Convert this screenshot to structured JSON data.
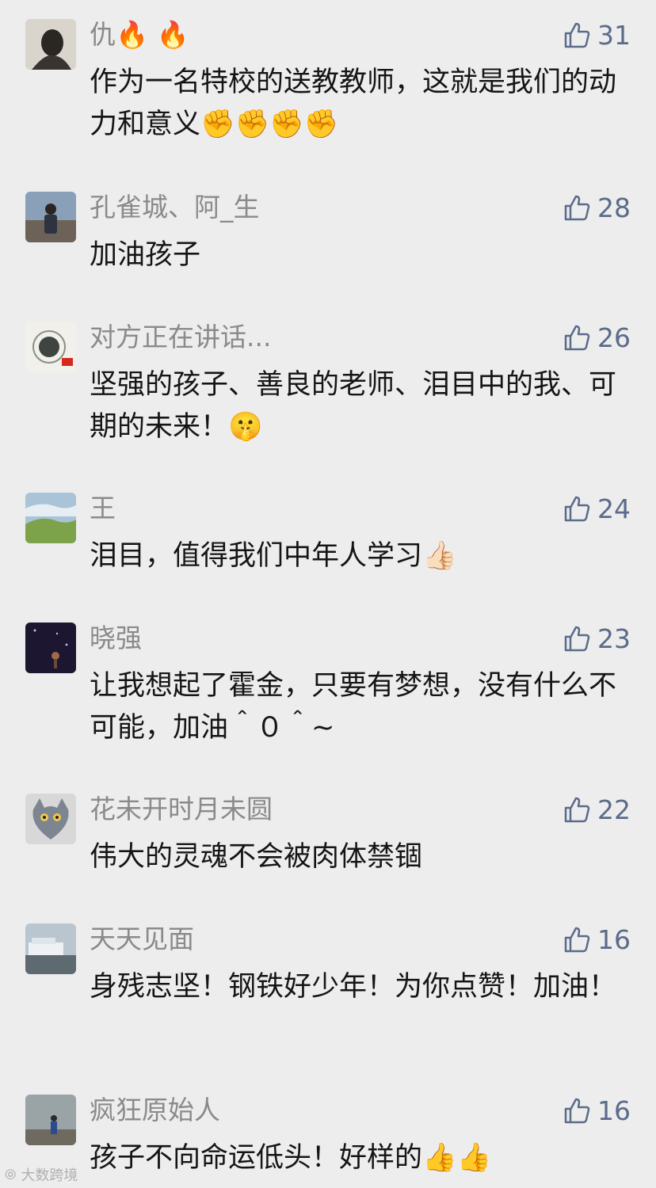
{
  "comments": [
    {
      "name": "仇🔥 🔥",
      "text": "作为一名特校的送教教师，这就是我们的动力和意义✊✊✊✊",
      "likes": "31",
      "avatar": "avatar-1"
    },
    {
      "name": "孔雀城、阿_生",
      "text": "加油孩子",
      "likes": "28",
      "avatar": "avatar-2"
    },
    {
      "name": "对方正在讲话...",
      "text": "坚强的孩子、善良的老师、泪目中的我、可期的未来！🤫",
      "likes": "26",
      "avatar": "avatar-3"
    },
    {
      "name": "王",
      "text": "泪目，值得我们中年人学习👍🏻",
      "likes": "24",
      "avatar": "avatar-4"
    },
    {
      "name": "晓强",
      "text": "让我想起了霍金，只要有梦想，没有什么不可能，加油＾０＾~",
      "likes": "23",
      "avatar": "avatar-5"
    },
    {
      "name": "花未开时月未圆",
      "text": "伟大的灵魂不会被肉体禁锢",
      "likes": "22",
      "avatar": "avatar-6"
    },
    {
      "name": "天天见面",
      "text": "身残志坚！钢铁好少年！为你点赞！加油！",
      "likes": "16",
      "avatar": "avatar-7"
    },
    {
      "name": "疯狂原始人",
      "text": "孩子不向命运低头！好样的👍👍",
      "likes": "16",
      "avatar": "avatar-8"
    }
  ],
  "like_icon": "thumbs-up-outline-icon",
  "colors": {
    "background": "#ededed",
    "name": "#8a8a8a",
    "text": "#151515",
    "like": "#5b6b8a"
  },
  "watermark": "大数跨境"
}
